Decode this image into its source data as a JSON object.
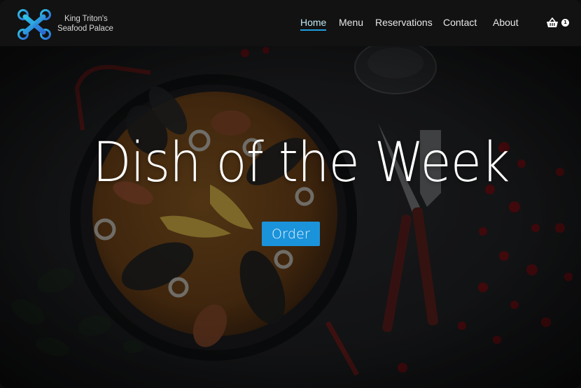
{
  "brand": {
    "name_line1": "King Triton's",
    "name_line2": "Seafood Palace",
    "logo_icon": "drone-x-icon"
  },
  "nav": {
    "items": [
      {
        "label": "Home",
        "active": true
      },
      {
        "label": "Menu",
        "active": false
      },
      {
        "label": "Reservations",
        "active": false
      },
      {
        "label": "Contact",
        "active": false
      },
      {
        "label": "About",
        "active": false
      }
    ],
    "accent": "#1e9ee0"
  },
  "cart": {
    "icon": "shopping-basket-icon",
    "count": "1"
  },
  "hero": {
    "title": "Dish of the Week",
    "button_label": "Order",
    "button_color": "#1a93db",
    "background": "paella-pan-photo"
  }
}
